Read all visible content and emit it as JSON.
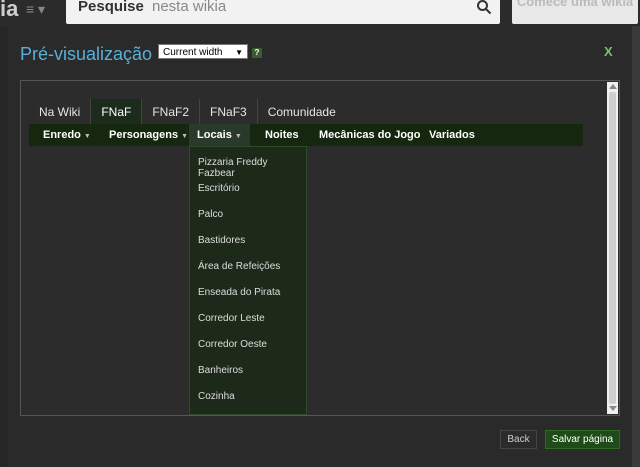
{
  "background": {
    "search": {
      "strong": "Pesquise",
      "rest": "nesta wikia"
    },
    "cta": "Comece uma wikia"
  },
  "modal": {
    "title": "Pré-visualização",
    "width_select": "Current width",
    "help": "?",
    "close": "X",
    "back": "Back",
    "save": "Salvar página"
  },
  "tabs": [
    "Na Wiki",
    "FNaF",
    "FNaF2",
    "FNaF3",
    "Comunidade"
  ],
  "subnav": [
    "Enredo",
    "Personagens",
    "Locais",
    "Noites",
    "Mecânicas do Jogo",
    "Variados"
  ],
  "dropdown": [
    "Pizzaria Freddy Fazbear",
    "Escritório",
    "Palco",
    "Bastidores",
    "Área de Refeições",
    "Enseada do Pirata",
    "Corredor Leste",
    "Corredor Oeste",
    "Banheiros",
    "Cozinha"
  ],
  "colors": {
    "title": "#5aaed8",
    "accent_green": "#1f4b19",
    "close": "#7ec26b"
  },
  "icons": {
    "search": "search-icon",
    "menu": "menu-icon",
    "close": "close-icon",
    "help": "help-icon"
  }
}
